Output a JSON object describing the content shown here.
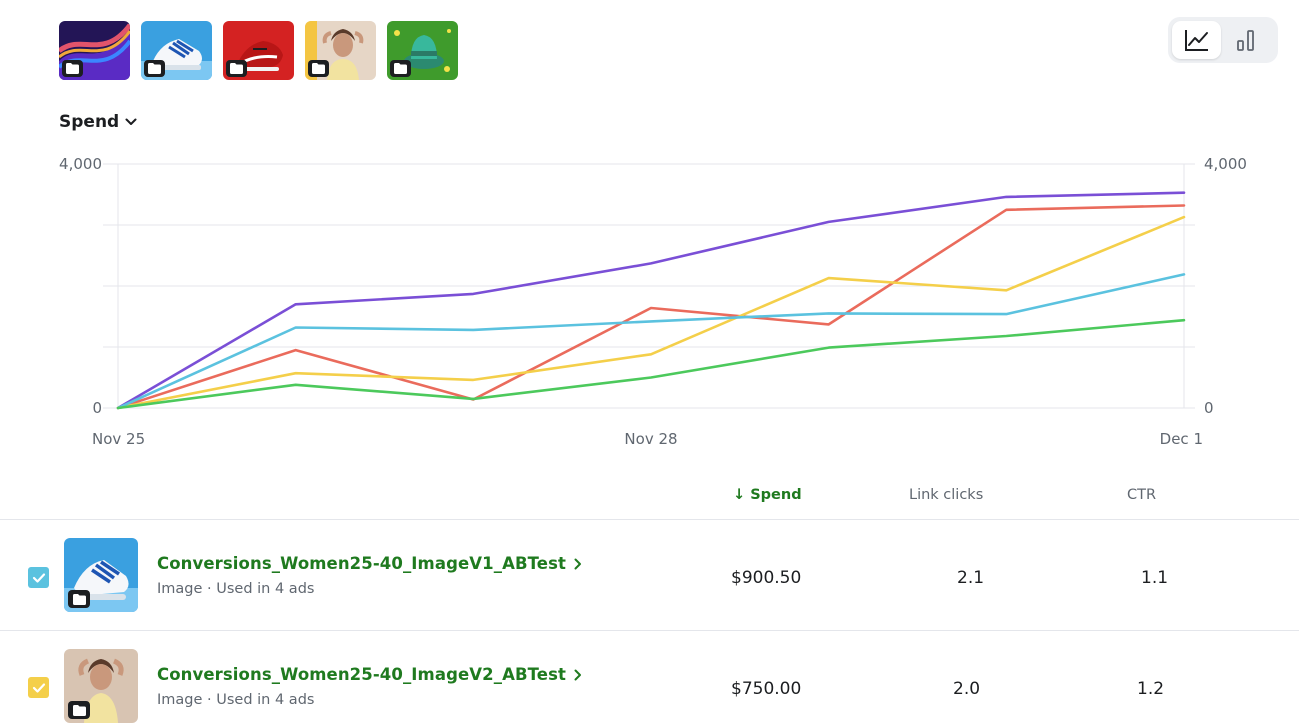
{
  "thumbnails": [
    {
      "id": "purple-waves",
      "colors": [
        "#2a1a6b",
        "#6a2fd1",
        "#e2546b",
        "#f0a93a"
      ]
    },
    {
      "id": "blue-sneaker",
      "colors": [
        "#3aa0e0",
        "#7cc7f2",
        "#ffffff",
        "#1e55b3"
      ]
    },
    {
      "id": "red-sneaker",
      "colors": [
        "#c81e1e",
        "#e23a3a",
        "#1c1e21",
        "#ffffff"
      ]
    },
    {
      "id": "woman-portrait",
      "colors": [
        "#f4c542",
        "#e9d9c8",
        "#b0806a",
        "#8a5a44"
      ]
    },
    {
      "id": "green-hat",
      "colors": [
        "#3a9a2a",
        "#5ccc44",
        "#33b39a",
        "#2b7a66"
      ]
    }
  ],
  "icons": {
    "folder": "folder-icon",
    "line_chart": "line-chart-icon",
    "bar_chart": "bar-chart-icon",
    "chevron_down": "chevron-down-icon",
    "chevron_right": "chevron-right-icon",
    "checkmark": "checkmark-icon"
  },
  "view_toggle": {
    "active": "line"
  },
  "metric_select": {
    "label": "Spend"
  },
  "chart_data": {
    "type": "line",
    "x": [
      "Nov 25",
      "Nov 26",
      "Nov 27",
      "Nov 28",
      "Nov 29",
      "Nov 30",
      "Dec 1"
    ],
    "x_tick_labels": [
      "Nov 25",
      "Nov 28",
      "Dec 1"
    ],
    "ylim": [
      0,
      4000
    ],
    "y_tick_labels_left": [
      "4,000",
      "0"
    ],
    "y_tick_labels_right": [
      "4,000",
      "0"
    ],
    "grid": true,
    "series": [
      {
        "color": "#7a4fd6",
        "values": [
          0,
          1700,
          1870,
          2370,
          3050,
          3460,
          3530
        ]
      },
      {
        "color": "#ea6b5c",
        "values": [
          0,
          950,
          140,
          1640,
          1370,
          3250,
          3320
        ]
      },
      {
        "color": "#f4cf4a",
        "values": [
          0,
          570,
          460,
          880,
          2130,
          1930,
          3130
        ]
      },
      {
        "color": "#5bc2df",
        "values": [
          0,
          1320,
          1280,
          1420,
          1550,
          1540,
          2190
        ]
      },
      {
        "color": "#4cc95c",
        "values": [
          0,
          380,
          150,
          500,
          990,
          1180,
          1440
        ]
      }
    ]
  },
  "table": {
    "headers": {
      "spend": "Spend",
      "link_clicks": "Link clicks",
      "ctr": "CTR"
    },
    "sort_arrow": "↓",
    "rows": [
      {
        "checked": true,
        "checkbox_color": "#5bc2df",
        "thumbnail": "blue-sneaker",
        "name": "Conversions_Women25-40_ImageV1_ABTest",
        "subtitle": "Image · Used in 4 ads",
        "spend": "$900.50",
        "link_clicks": "2.1",
        "ctr": "1.1"
      },
      {
        "checked": true,
        "checkbox_color": "#f4cf4a",
        "thumbnail": "woman-portrait",
        "name": "Conversions_Women25-40_ImageV2_ABTest",
        "subtitle": "Image · Used in 4 ads",
        "spend": "$750.00",
        "link_clicks": "2.0",
        "ctr": "1.2"
      }
    ]
  }
}
